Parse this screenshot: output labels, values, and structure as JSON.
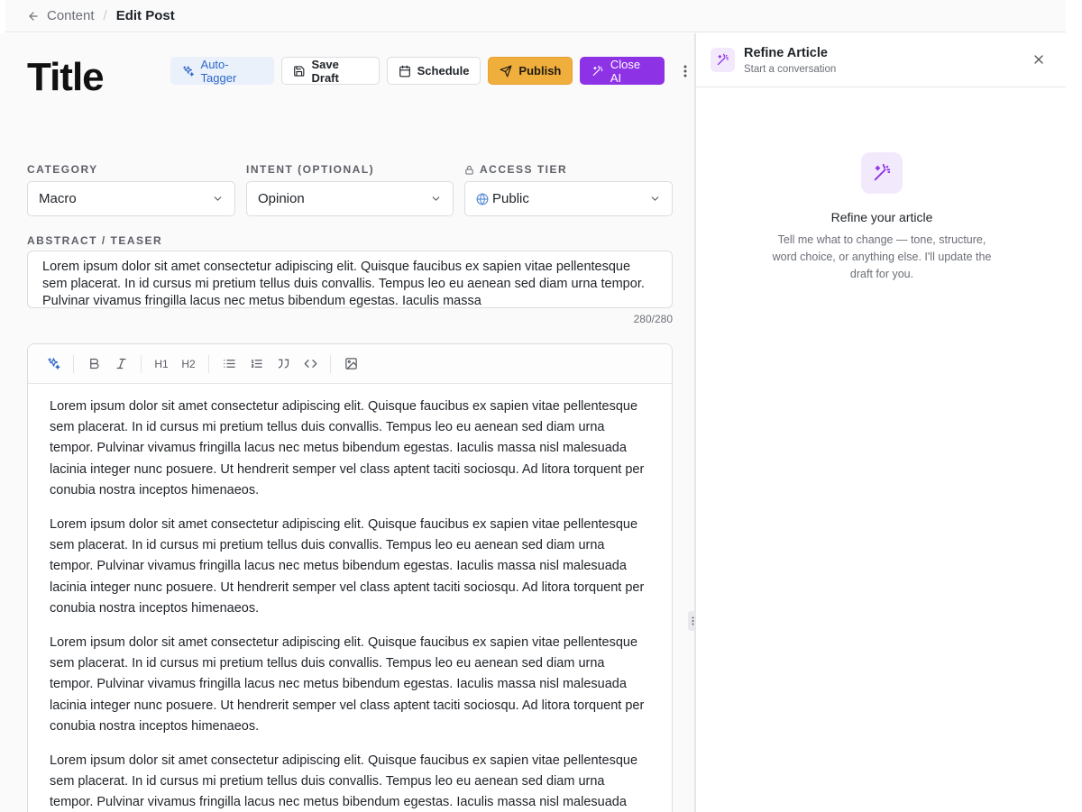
{
  "breadcrumb": {
    "parent": "Content",
    "current": "Edit Post"
  },
  "editor": {
    "title": "Title",
    "actions": {
      "auto_tagger": "Auto-Tagger",
      "save_draft": "Save Draft",
      "schedule": "Schedule",
      "publish": "Publish",
      "close_ai": "Close AI"
    },
    "fields": {
      "category": {
        "label": "CATEGORY",
        "value": "Macro"
      },
      "intent": {
        "label": "INTENT (OPTIONAL)",
        "value": "Opinion"
      },
      "access_tier": {
        "label": "ACCESS TIER",
        "value": "Public"
      }
    },
    "abstract": {
      "label": "ABSTRACT / TEASER",
      "value": "Lorem ipsum dolor sit amet consectetur adipiscing elit. Quisque faucibus ex sapien vitae pellentesque sem placerat. In id cursus mi pretium tellus duis convallis. Tempus leo eu aenean sed diam urna tempor. Pulvinar vivamus fringilla lacus nec metus bibendum egestas. Iaculis massa",
      "counter": "280/280"
    },
    "toolbar": [
      "magic-icon",
      "bold-icon",
      "italic-icon",
      "heading-1-icon",
      "heading-2-icon",
      "bullet-list-icon",
      "numbered-list-icon",
      "quote-icon",
      "code-icon",
      "image-icon"
    ],
    "toolbar_text": {
      "h1": "H1",
      "h2": "H2"
    },
    "body": [
      "Lorem ipsum dolor sit amet consectetur adipiscing elit. Quisque faucibus ex sapien vitae pellentesque sem placerat. In id cursus mi pretium tellus duis convallis. Tempus leo eu aenean sed diam urna tempor. Pulvinar vivamus fringilla lacus nec metus bibendum egestas. Iaculis massa nisl malesuada lacinia integer nunc posuere. Ut hendrerit semper vel class aptent taciti sociosqu. Ad litora torquent per conubia nostra inceptos himenaeos.",
      "Lorem ipsum dolor sit amet consectetur adipiscing elit. Quisque faucibus ex sapien vitae pellentesque sem placerat. In id cursus mi pretium tellus duis convallis. Tempus leo eu aenean sed diam urna tempor. Pulvinar vivamus fringilla lacus nec metus bibendum egestas. Iaculis massa nisl malesuada lacinia integer nunc posuere. Ut hendrerit semper vel class aptent taciti sociosqu. Ad litora torquent per conubia nostra inceptos himenaeos.",
      "Lorem ipsum dolor sit amet consectetur adipiscing elit. Quisque faucibus ex sapien vitae pellentesque sem placerat. In id cursus mi pretium tellus duis convallis. Tempus leo eu aenean sed diam urna tempor. Pulvinar vivamus fringilla lacus nec metus bibendum egestas. Iaculis massa nisl malesuada lacinia integer nunc posuere. Ut hendrerit semper vel class aptent taciti sociosqu. Ad litora torquent per conubia nostra inceptos himenaeos.",
      "Lorem ipsum dolor sit amet consectetur adipiscing elit. Quisque faucibus ex sapien vitae pellentesque sem placerat. In id cursus mi pretium tellus duis convallis. Tempus leo eu aenean sed diam urna tempor. Pulvinar vivamus fringilla lacus nec metus bibendum egestas. Iaculis massa nisl malesuada lacinia integer"
    ]
  },
  "ai_panel": {
    "title": "Refine Article",
    "subtitle": "Start a conversation",
    "empty_title": "Refine your article",
    "empty_description": "Tell me what to change — tone, structure, word choice, or anything else. I'll update the draft for you."
  },
  "colors": {
    "publish": "#f0ae3c",
    "close_ai": "#8e32e6",
    "auto_tagger_bg": "#eaf1fb",
    "auto_tagger_text": "#2f67c8",
    "ai_accent": "#8e32e6"
  }
}
